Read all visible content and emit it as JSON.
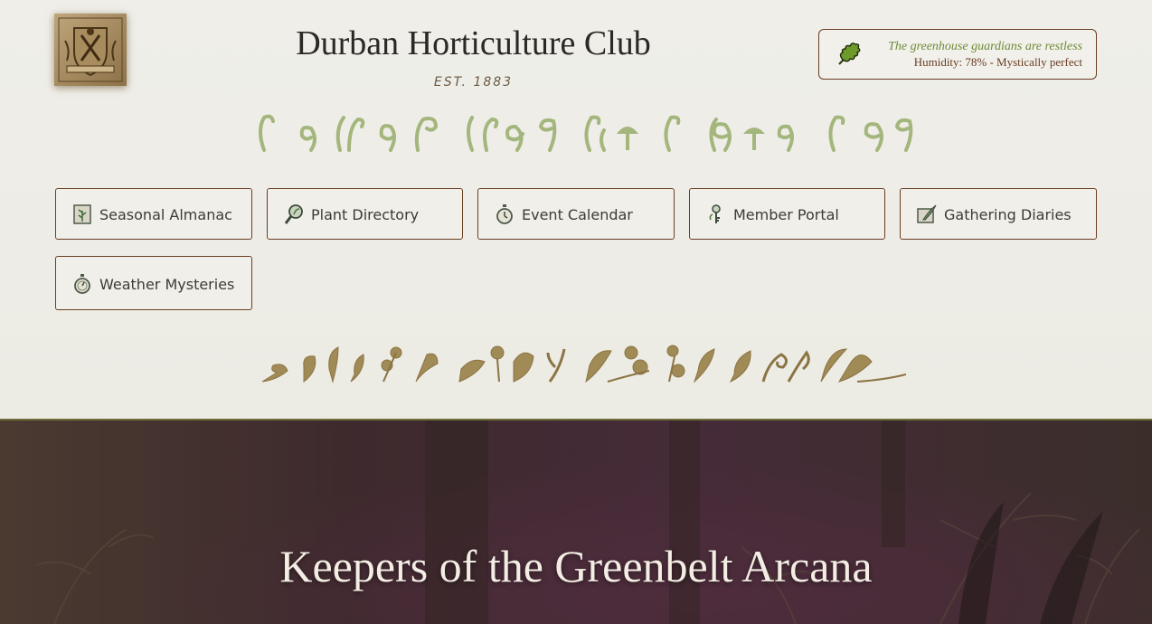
{
  "header": {
    "title": "Durban Horticulture Club",
    "established": "EST. 1883",
    "logo_icon": "crest-emblem-icon"
  },
  "status": {
    "icon": "oak-leaf-icon",
    "headline": "The greenhouse guardians are restless",
    "detail": "Humidity: 78% - Mystically perfect"
  },
  "nav": {
    "items": [
      {
        "label": "Seasonal Almanac",
        "icon": "almanac-book-icon"
      },
      {
        "label": "Plant Directory",
        "icon": "magnifier-leaf-icon"
      },
      {
        "label": "Event Calendar",
        "icon": "pocket-watch-icon"
      },
      {
        "label": "Member Portal",
        "icon": "flower-key-icon"
      },
      {
        "label": "Gathering Diaries",
        "icon": "quill-diary-icon"
      },
      {
        "label": "Weather Mysteries",
        "icon": "stopwatch-icon"
      }
    ]
  },
  "hero": {
    "title": "Keepers of the Greenbelt Arcana"
  },
  "colors": {
    "accent_brown": "#6a3f23",
    "accent_green": "#6e8a39",
    "fern_green": "#a3b67c",
    "gold_ornament": "#a08a55",
    "hero_background": "#3e2a2d"
  }
}
